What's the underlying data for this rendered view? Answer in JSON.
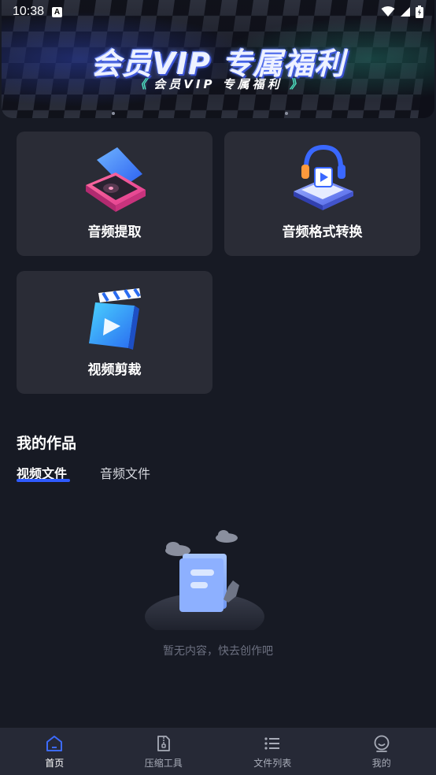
{
  "status_bar": {
    "time": "10:38",
    "notification_icon": "A"
  },
  "banner": {
    "title": "会员VIP 专属福利",
    "subtitle": "会员VIP 专属福利",
    "sub_left": "《",
    "sub_right": "》"
  },
  "tools": [
    {
      "label": "音频提取",
      "icon": "audio-extract-icon"
    },
    {
      "label": "音频格式转换",
      "icon": "audio-convert-icon"
    },
    {
      "label": "视频剪裁",
      "icon": "video-crop-icon"
    }
  ],
  "works": {
    "title": "我的作品",
    "tabs": [
      {
        "label": "视频文件",
        "active": true
      },
      {
        "label": "音频文件",
        "active": false
      }
    ],
    "empty_text": "暂无内容，快去创作吧"
  },
  "bottom_nav": [
    {
      "label": "首页",
      "icon": "home-icon",
      "active": true
    },
    {
      "label": "压缩工具",
      "icon": "compress-icon",
      "active": false
    },
    {
      "label": "文件列表",
      "icon": "list-icon",
      "active": false
    },
    {
      "label": "我的",
      "icon": "profile-icon",
      "active": false
    }
  ],
  "colors": {
    "background": "#171a24",
    "card": "#2a2c36",
    "accent": "#2f5bff",
    "nav": "#262936"
  }
}
